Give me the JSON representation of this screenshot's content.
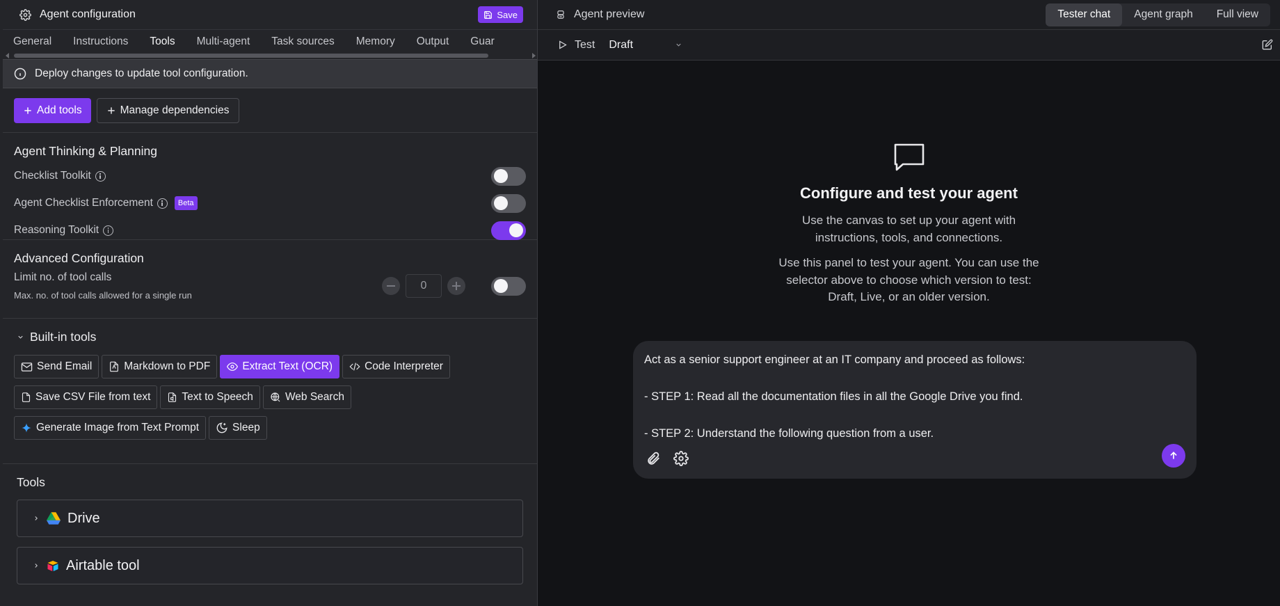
{
  "left": {
    "title": "Agent configuration",
    "save_label": "Save",
    "tabs": [
      "General",
      "Instructions",
      "Tools",
      "Multi-agent",
      "Task sources",
      "Memory",
      "Output",
      "Guar"
    ],
    "notice": "Deploy changes to update tool configuration.",
    "add_tools": "Add tools",
    "manage_dependencies": "Manage dependencies",
    "thinking": {
      "title": "Agent Thinking & Planning",
      "items": [
        {
          "label": "Checklist Toolkit",
          "enabled": false
        },
        {
          "label": "Agent Checklist Enforcement",
          "badge": "Beta",
          "enabled": false
        },
        {
          "label": "Reasoning Toolkit",
          "enabled": true
        }
      ]
    },
    "advanced": {
      "title": "Advanced Configuration",
      "limit_label": "Limit no. of tool calls",
      "limit_desc": "Max. no. of tool calls allowed for a single run",
      "limit_value": "0",
      "limit_enabled": false
    },
    "builtin": {
      "title": "Built-in tools",
      "chips": [
        [
          "Send Email",
          "Markdown to PDF",
          "Extract Text (OCR)",
          "Code Interpreter"
        ],
        [
          "Save CSV File from text",
          "Text to Speech",
          "Web Search"
        ],
        [
          "Generate Image from Text Prompt",
          "Sleep"
        ]
      ],
      "active": "Extract Text (OCR)"
    },
    "tools": {
      "title": "Tools",
      "items": [
        "Drive",
        "Airtable tool"
      ]
    }
  },
  "right": {
    "title": "Agent preview",
    "views": [
      "Tester chat",
      "Agent graph",
      "Full view"
    ],
    "active_view": "Tester chat",
    "test_label": "Test",
    "version": "Draft",
    "empty_title": "Configure and test your agent",
    "empty_p1a": "Use the canvas to set up your agent with",
    "empty_p1b": "instructions, tools, and connections.",
    "empty_p2a": "Use this panel to test your agent. You can use the",
    "empty_p2b": "selector above to choose which version to test:",
    "empty_p2c": "Draft, Live, or an older version.",
    "composer_lines": [
      "Act as a senior support engineer at an IT company and proceed as follows:",
      "",
      "- STEP 1: Read all the documentation files in all the Google Drive you find.",
      "",
      "- STEP 2: Understand the following question from a user."
    ]
  },
  "colors": {
    "accent": "#7c3aed",
    "panel": "#242529",
    "preview_bg": "#121316"
  }
}
